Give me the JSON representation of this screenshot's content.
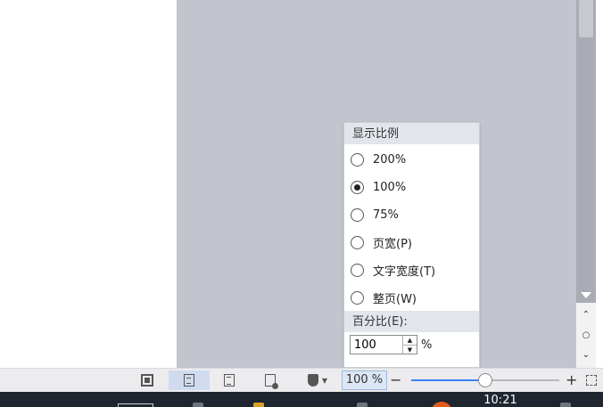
{
  "zoom_popup": {
    "section_title": "显示比例",
    "options": [
      {
        "label": "200%",
        "checked": false
      },
      {
        "label": "100%",
        "checked": true
      },
      {
        "label": "75%",
        "checked": false
      },
      {
        "label": "页宽(P)",
        "checked": false
      },
      {
        "label": "文字宽度(T)",
        "checked": false
      },
      {
        "label": "整页(W)",
        "checked": false
      }
    ],
    "percent_title": "百分比(E):",
    "percent_value": "100",
    "percent_unit": "%"
  },
  "statusbar": {
    "zoom_display": "100 %",
    "zoom_minus": "−",
    "zoom_plus": "+",
    "zoom_slider_fraction": 0.5
  },
  "taskbar": {
    "clock": "10:21"
  },
  "colors": {
    "canvas": "#c2c5ce",
    "popup_header": "#e3e5ec",
    "active_view": "#d0dbef",
    "slider_fill": "#3b82f6",
    "taskbar": "#1f2630"
  }
}
